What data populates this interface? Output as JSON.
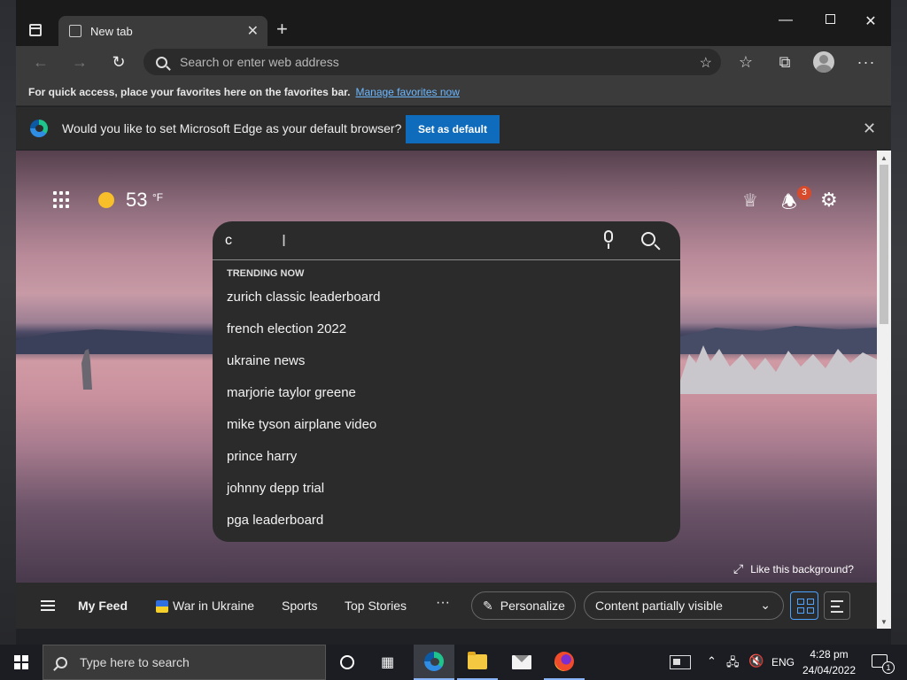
{
  "browser": {
    "tab_title": "New tab",
    "tab_close": "✕",
    "new_tab": "+",
    "window_controls": {
      "minimize": "—",
      "close": "✕"
    },
    "address_placeholder": "Search or enter web address",
    "more_label": "···"
  },
  "favorites_bar": {
    "message": "For quick access, place your favorites here on the favorites bar.",
    "manage_link": "Manage favorites now"
  },
  "infobar": {
    "question": "Would you like to set Microsoft Edge as your default browser?",
    "set_default_label": "Set as default",
    "close": "✕"
  },
  "new_tab_page": {
    "weather": {
      "temp": "53",
      "unit": "°F"
    },
    "notification_count": "3",
    "search": {
      "query": "c",
      "trending_heading": "TRENDING NOW",
      "suggestions": [
        "zurich classic leaderboard",
        "french election 2022",
        "ukraine news",
        "marjorie taylor greene",
        "mike tyson airplane video",
        "prince harry",
        "johnny depp trial",
        "pga leaderboard"
      ]
    },
    "like_background": "Like this background?"
  },
  "feed_bar": {
    "tabs": [
      "My Feed",
      "War in Ukraine",
      "Sports",
      "Top Stories"
    ],
    "more": "···",
    "personalize_label": "Personalize",
    "content_visibility": "Content partially visible"
  },
  "taskbar": {
    "search_placeholder": "Type here to search",
    "language": "ENG",
    "time": "4:28 pm",
    "date": "24/04/2022",
    "notification_count": "1"
  },
  "icons": {
    "rewards": "rewards-icon",
    "bell": "bell-icon",
    "settings": "gear-icon"
  },
  "colors": {
    "accent_button": "#0f6cbd",
    "link": "#6cb8ff",
    "badge": "#d84a2c"
  }
}
